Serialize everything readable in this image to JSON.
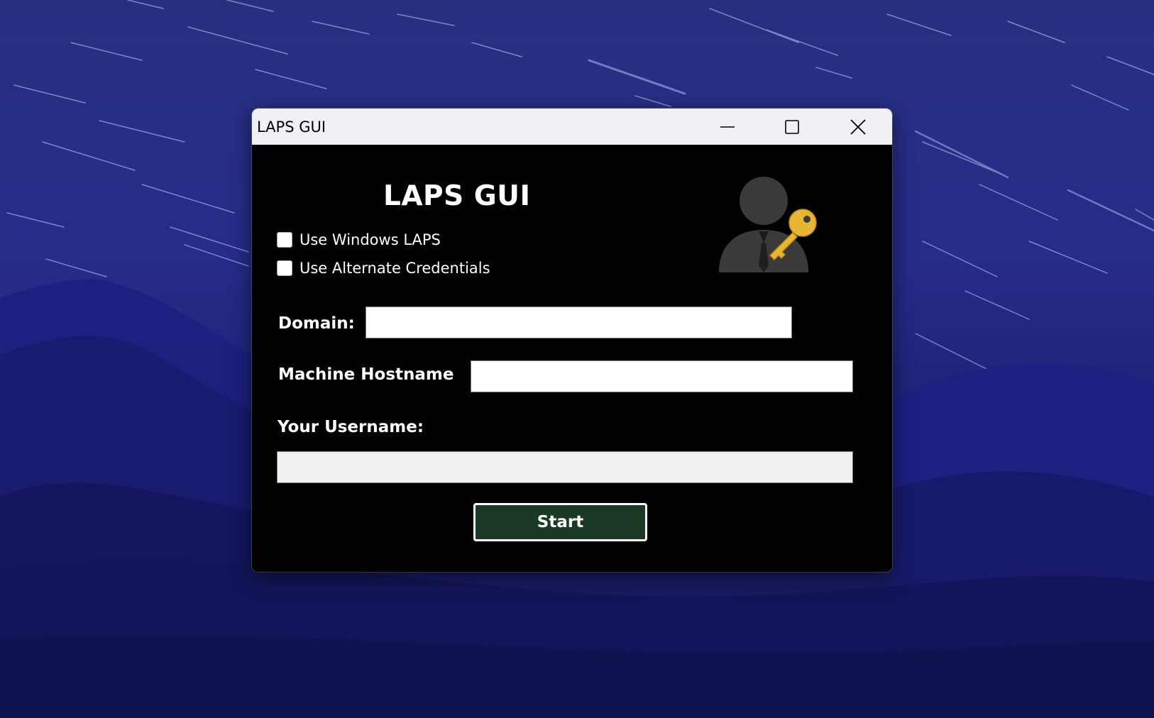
{
  "window": {
    "title": "LAPS GUI",
    "controls": {
      "minimize": "minimize-icon",
      "maximize": "maximize-icon",
      "close": "close-icon"
    }
  },
  "app": {
    "heading": "LAPS GUI",
    "logo_icon": "user-key-icon",
    "checkboxes": [
      {
        "label": "Use Windows LAPS",
        "checked": false
      },
      {
        "label": "Use Alternate Credentials",
        "checked": false
      }
    ],
    "fields": {
      "domain": {
        "label": "Domain:",
        "value": ""
      },
      "hostname": {
        "label": "Machine Hostname",
        "value": ""
      },
      "username": {
        "label": "Your Username:",
        "value": ""
      }
    },
    "start_label": "Start"
  },
  "colors": {
    "window_bg": "#000000",
    "titlebar_bg": "#f0f0f5",
    "button_bg": "#1a3a26",
    "key_gold": "#e8b534",
    "person_gray": "#3a3a3a",
    "desktop_blue": "#262c8a"
  }
}
